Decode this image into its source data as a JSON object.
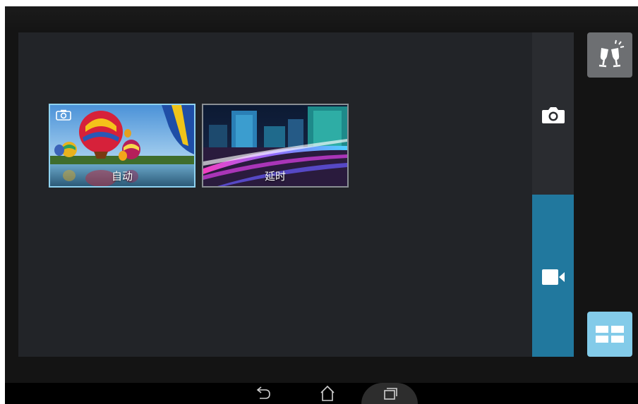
{
  "modes": [
    {
      "label": "自动",
      "selected": true
    },
    {
      "label": "延时",
      "selected": false
    }
  ],
  "mode_rail": {
    "photo_icon": "camera-icon",
    "video_icon": "video-camera-icon",
    "active": "video"
  },
  "side_buttons": {
    "party_icon": "toast-glasses-icon",
    "grid_icon": "grid-view-icon"
  },
  "navbar": {
    "back_icon": "back-icon",
    "home_icon": "home-icon",
    "recent_icon": "recent-apps-icon"
  },
  "colors": {
    "accent": "#21789e",
    "grid_button": "#83cbe9",
    "selected_border": "#8fd2f0"
  }
}
